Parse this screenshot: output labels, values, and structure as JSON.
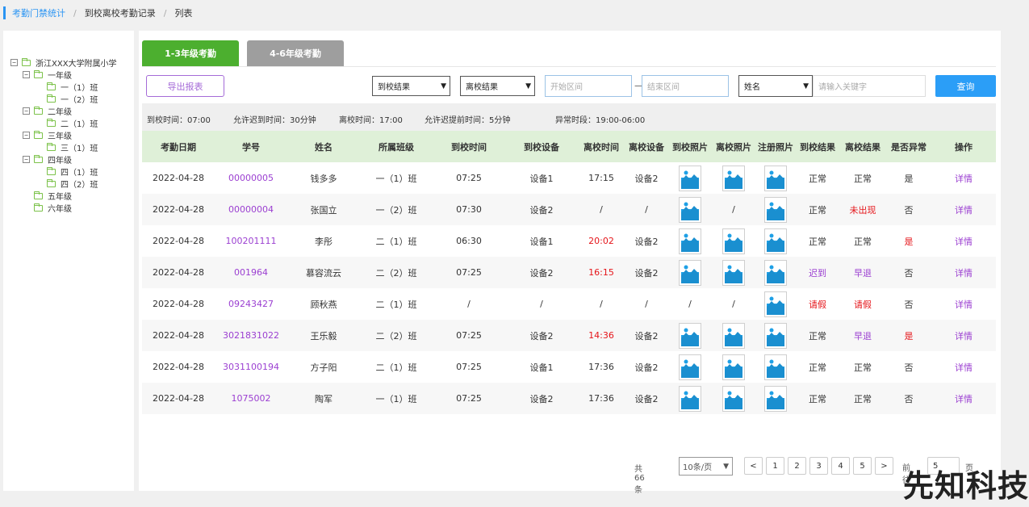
{
  "breadcrumb": [
    "考勤门禁统计",
    "到校离校考勤记录",
    "列表"
  ],
  "tree": {
    "root": "浙江XXX大学附属小学",
    "nodes": [
      {
        "label": "一年级",
        "toggle": "⊟",
        "level": 1
      },
      {
        "label": "一（1）班",
        "toggle": "",
        "level": 2
      },
      {
        "label": "一（2）班",
        "toggle": "",
        "level": 2
      },
      {
        "label": "二年级",
        "toggle": "⊟",
        "level": 1
      },
      {
        "label": "二（1）班",
        "toggle": "",
        "level": 2
      },
      {
        "label": "三年级",
        "toggle": "⊟",
        "level": 1
      },
      {
        "label": "三（1）班",
        "toggle": "",
        "level": 2
      },
      {
        "label": "四年级",
        "toggle": "⊟",
        "level": 1
      },
      {
        "label": "四（1）班",
        "toggle": "",
        "level": 2
      },
      {
        "label": "四（2）班",
        "toggle": "",
        "level": 2
      },
      {
        "label": "五年级",
        "toggle": "",
        "level": 1
      },
      {
        "label": "六年级",
        "toggle": "",
        "level": 1
      }
    ]
  },
  "tabs": [
    "1-3年级考勤",
    "4-6年级考勤"
  ],
  "toolbar": {
    "export": "导出报表",
    "arrive_result": "到校结果",
    "leave_result": "离校结果",
    "start_placeholder": "开始区间",
    "end_placeholder": "结束区间",
    "dash": "—",
    "search_field": "姓名",
    "keyword_placeholder": "请输入关键字",
    "query": "查询"
  },
  "info": {
    "arrive_time": "到校时间：07:00",
    "late_allowed": "允许迟到时间：30分钟",
    "leave_time": "离校时间：17:00",
    "early_allowed": "允许迟提前时间：5分钟",
    "abnormal_period": "异常时段：19:00-06:00"
  },
  "columns": [
    "考勤日期",
    "学号",
    "姓名",
    "所属班级",
    "到校时间",
    "到校设备",
    "离校时间",
    "离校设备",
    "到校照片",
    "离校照片",
    "注册照片",
    "到校结果",
    "离校结果",
    "是否异常",
    "操作"
  ],
  "rows": [
    {
      "date": "2022-04-28",
      "id": "00000005",
      "name": "钱多多",
      "class": "一（1）班",
      "arrive": "07:25",
      "arrive_dev": "设备1",
      "leave": "17:15",
      "leave_red": false,
      "leave_dev": "设备2",
      "p1": true,
      "p2": true,
      "p3": true,
      "r1": "正常",
      "r1c": "",
      "r2": "正常",
      "r2c": "",
      "abn": "是",
      "abnc": "",
      "op": "详情"
    },
    {
      "date": "2022-04-28",
      "id": "00000004",
      "name": "张国立",
      "class": "一（2）班",
      "arrive": "07:30",
      "arrive_dev": "设备2",
      "leave": "/",
      "leave_red": false,
      "leave_dev": "/",
      "p1": true,
      "p2": false,
      "p3": true,
      "r1": "正常",
      "r1c": "",
      "r2": "未出现",
      "r2c": "red",
      "abn": "否",
      "abnc": "",
      "op": "详情"
    },
    {
      "date": "2022-04-28",
      "id": "100201111",
      "name": "李彤",
      "class": "二（1）班",
      "arrive": "06:30",
      "arrive_dev": "设备1",
      "leave": "20:02",
      "leave_red": true,
      "leave_dev": "设备2",
      "p1": true,
      "p2": true,
      "p3": true,
      "r1": "正常",
      "r1c": "",
      "r2": "正常",
      "r2c": "",
      "abn": "是",
      "abnc": "red",
      "op": "详情"
    },
    {
      "date": "2022-04-28",
      "id": "001964",
      "name": "慕容流云",
      "class": "二（2）班",
      "arrive": "07:25",
      "arrive_dev": "设备2",
      "leave": "16:15",
      "leave_red": true,
      "leave_dev": "设备2",
      "p1": true,
      "p2": true,
      "p3": true,
      "r1": "迟到",
      "r1c": "purple",
      "r2": "早退",
      "r2c": "purple",
      "abn": "否",
      "abnc": "",
      "op": "详情"
    },
    {
      "date": "2022-04-28",
      "id": "09243427",
      "name": "顾秋燕",
      "class": "二（1）班",
      "arrive": "/",
      "arrive_dev": "/",
      "leave": "/",
      "leave_red": false,
      "leave_dev": "/",
      "p1": false,
      "p2": false,
      "p3": true,
      "r1": "请假",
      "r1c": "red",
      "r2": "请假",
      "r2c": "red",
      "abn": "否",
      "abnc": "",
      "op": "详情"
    },
    {
      "date": "2022-04-28",
      "id": "3021831022",
      "name": "王乐毅",
      "class": "二（2）班",
      "arrive": "07:25",
      "arrive_dev": "设备2",
      "leave": "14:36",
      "leave_red": true,
      "leave_dev": "设备2",
      "p1": true,
      "p2": true,
      "p3": true,
      "r1": "正常",
      "r1c": "",
      "r2": "早退",
      "r2c": "purple",
      "abn": "是",
      "abnc": "red",
      "op": "详情"
    },
    {
      "date": "2022-04-28",
      "id": "3031100194",
      "name": "方子阳",
      "class": "二（1）班",
      "arrive": "07:25",
      "arrive_dev": "设备1",
      "leave": "17:36",
      "leave_red": false,
      "leave_dev": "设备2",
      "p1": true,
      "p2": true,
      "p3": true,
      "r1": "正常",
      "r1c": "",
      "r2": "正常",
      "r2c": "",
      "abn": "否",
      "abnc": "",
      "op": "详情"
    },
    {
      "date": "2022-04-28",
      "id": "1075002",
      "name": "陶军",
      "class": "一（1）班",
      "arrive": "07:25",
      "arrive_dev": "设备2",
      "leave": "17:36",
      "leave_red": false,
      "leave_dev": "设备2",
      "p1": true,
      "p2": true,
      "p3": true,
      "r1": "正常",
      "r1c": "",
      "r2": "正常",
      "r2c": "",
      "abn": "否",
      "abnc": "",
      "op": "详情"
    }
  ],
  "pager": {
    "total": "共66条",
    "page_size": "10条/页",
    "prev": "<",
    "pages": [
      "1",
      "2",
      "3",
      "4",
      "5"
    ],
    "next": ">",
    "goto_label": "前往",
    "goto_value": "5",
    "goto_suffix": "页"
  },
  "watermark": "先知科技",
  "colors": {
    "accent": "#2b95f3",
    "tab_active": "#4caf2f",
    "purple": "#9b3fd1",
    "red": "#e5151a",
    "header_bg": "#dff0d8"
  }
}
